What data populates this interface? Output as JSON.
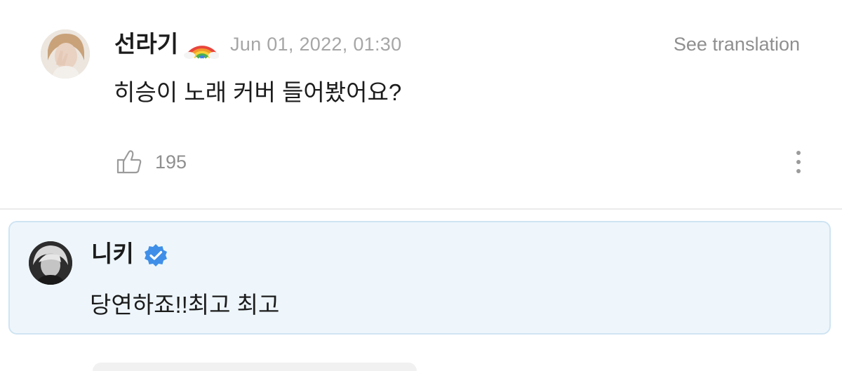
{
  "comment": {
    "username": "선라기",
    "username_emoji": "rainbow-emoji",
    "timestamp": "Jun 01, 2022, 01:30",
    "translate_label": "See translation",
    "text": "히승이 노래 커버 들어봤어요?",
    "like_icon": "thumbs-up-icon",
    "like_count": "195",
    "more_icon": "vertical-ellipsis-icon"
  },
  "reply": {
    "username": "니키",
    "badge_icon": "verified-badge-icon",
    "text": "당연하죠!!최고 최고"
  },
  "colors": {
    "reply_background": "#eef6fc",
    "reply_border": "#cfe4f2",
    "verified_blue": "#3f8fe8",
    "muted_text": "#a6a6a6"
  }
}
